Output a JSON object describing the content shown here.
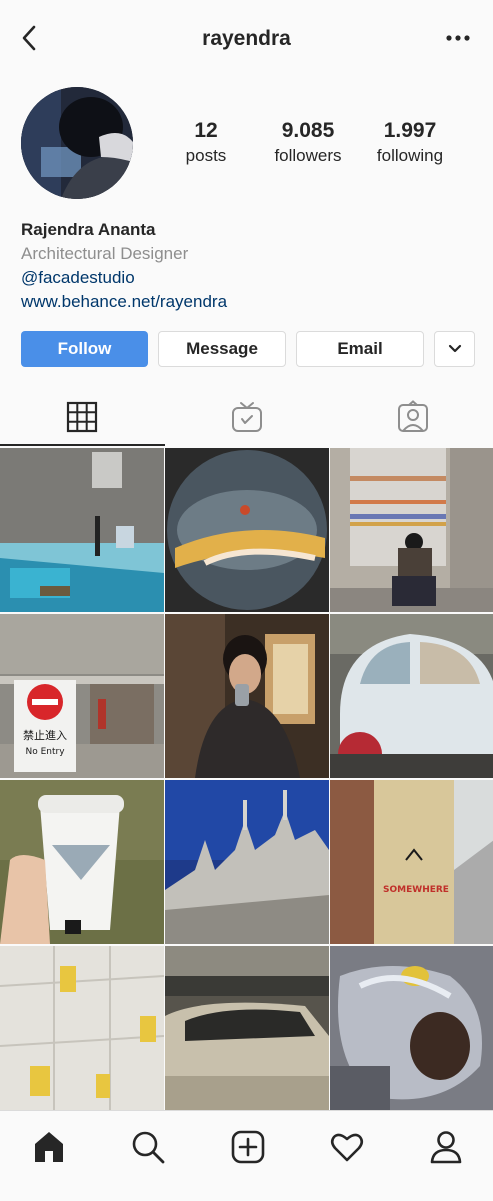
{
  "header": {
    "username": "rayendra",
    "back_icon": "chevron-left-icon",
    "more_icon": "more-options-icon"
  },
  "stats": [
    {
      "value": "12",
      "label": "posts"
    },
    {
      "value": "9.085",
      "label": "followers"
    },
    {
      "value": "1.997",
      "label": "following"
    }
  ],
  "bio": {
    "name": "Rajendra Ananta",
    "category": "Architectural Designer",
    "handle": "@facadestudio",
    "website": "www.behance.net/rayendra"
  },
  "actions": {
    "follow": "Follow",
    "message": "Message",
    "email": "Email",
    "dropdown_icon": "chevron-down-icon"
  },
  "tabs": [
    "grid-icon",
    "igtv-icon",
    "tagged-icon"
  ],
  "grid_photos": [
    {
      "text": ""
    },
    {
      "text": ""
    },
    {
      "text": ""
    },
    {
      "text": "禁止進入",
      "text2": "No Entry"
    },
    {
      "text": ""
    },
    {
      "text": ""
    },
    {
      "text": ""
    },
    {
      "text": ""
    },
    {
      "text": "SOMEWHERE"
    },
    {
      "text": ""
    },
    {
      "text": ""
    },
    {
      "text": ""
    }
  ],
  "colors": {
    "accent": "#4a8fe8",
    "link": "#00376b",
    "muted": "#8e8e8e"
  },
  "bottom_nav": [
    "home-icon",
    "search-icon",
    "new-post-icon",
    "activity-heart-icon",
    "profile-icon"
  ]
}
